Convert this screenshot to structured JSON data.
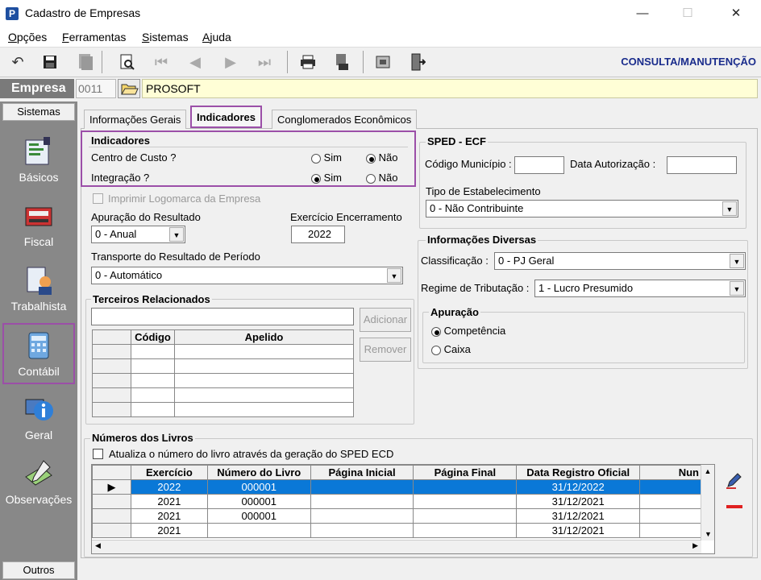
{
  "window": {
    "title": "Cadastro de Empresas",
    "app_icon": "P",
    "minimize": "—",
    "maximize": "☐",
    "close": "✕"
  },
  "menu": [
    {
      "accel": "O",
      "rest": "pções"
    },
    {
      "accel": "F",
      "rest": "erramentas"
    },
    {
      "accel": "S",
      "rest": "istemas"
    },
    {
      "accel": "A",
      "rest": "juda"
    }
  ],
  "toolbar": {
    "mode": "CONSULTA/MANUTENÇÃO"
  },
  "empresa": {
    "label": "Empresa",
    "code": "0011",
    "name": "PROSOFT"
  },
  "sidebar": {
    "header": "Sistemas",
    "footer": "Outros",
    "items": [
      {
        "label": "Básicos",
        "icon": "basicos-icon"
      },
      {
        "label": "Fiscal",
        "icon": "fiscal-icon"
      },
      {
        "label": "Trabalhista",
        "icon": "trabalhista-icon"
      },
      {
        "label": "Contábil",
        "icon": "contabil-icon"
      },
      {
        "label": "Geral",
        "icon": "geral-icon"
      },
      {
        "label": "Observações",
        "icon": "observacoes-icon"
      }
    ]
  },
  "tabs": [
    "Informações Gerais",
    "Indicadores",
    "Conglomerados Econômicos"
  ],
  "indicadores": {
    "title": "Indicadores",
    "centro_custo": {
      "label": "Centro de Custo ?",
      "sim": "Sim",
      "nao": "Não",
      "value": "Não"
    },
    "integracao": {
      "label": "Integração ?",
      "sim": "Sim",
      "nao": "Não",
      "value": "Sim"
    }
  },
  "imprimir_logomarca": "Imprimir Logomarca da Empresa",
  "apuracao_resultado": {
    "label": "Apuração do Resultado",
    "value": "0 - Anual"
  },
  "exercicio_encerramento": {
    "label": "Exercício Encerramento",
    "value": "2022"
  },
  "transporte_resultado": {
    "label": "Transporte do Resultado de Período",
    "value": "0 - Automático"
  },
  "terceiros": {
    "title": "Terceiros Relacionados",
    "adicionar": "Adicionar",
    "remover": "Remover",
    "headers": [
      "Código",
      "Apelido"
    ]
  },
  "sped_ecf": {
    "title": "SPED - ECF",
    "codigo_municipio": "Código Município :",
    "data_autorizacao": "Data Autorização :",
    "tipo_estab_label": "Tipo de Estabelecimento",
    "tipo_estab_value": "0 - Não Contribuinte"
  },
  "info_diversas": {
    "title": "Informações Diversas",
    "classificacao_label": "Classificação :",
    "classificacao_value": "0 - PJ Geral",
    "regime_label": "Regime de Tributação :",
    "regime_value": "1 - Lucro Presumido"
  },
  "apuracao": {
    "title": "Apuração",
    "competencia": "Competência",
    "caixa": "Caixa",
    "value": "Competência"
  },
  "livros": {
    "title": "Números dos Livros",
    "atualiza": "Atualiza o número do livro através da geração do SPED ECD",
    "headers": [
      "Exercício",
      "Número do Livro",
      "Página Inicial",
      "Página Final",
      "Data Registro Oficial",
      "Nun"
    ],
    "rows": [
      {
        "exercicio": "2022",
        "numero": "000001",
        "pag_ini": "",
        "pag_fim": "",
        "data": "31/12/2022"
      },
      {
        "exercicio": "2021",
        "numero": "000001",
        "pag_ini": "",
        "pag_fim": "",
        "data": "31/12/2021"
      },
      {
        "exercicio": "2021",
        "numero": "000001",
        "pag_ini": "",
        "pag_fim": "",
        "data": "31/12/2021"
      },
      {
        "exercicio": "2021",
        "numero": "",
        "pag_ini": "",
        "pag_fim": "",
        "data": "31/12/2021"
      }
    ]
  },
  "colors": {
    "accent_border": "#9b4fa8",
    "selected_row": "#0a78d7",
    "mode_label": "#1a2c8c"
  }
}
